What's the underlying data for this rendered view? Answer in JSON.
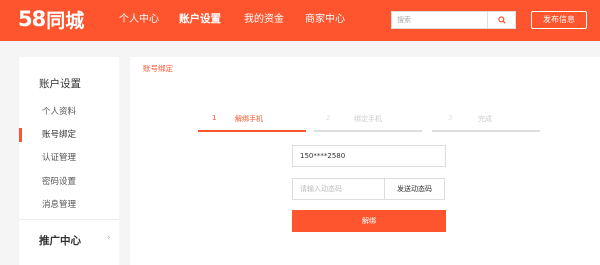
{
  "header": {
    "logo_number": "58",
    "logo_text": "同城",
    "nav": [
      "个人中心",
      "账户设置",
      "我的资金",
      "商家中心"
    ],
    "active_nav": "账户设置",
    "search_placeholder": "搜索",
    "post_button": "发布信息"
  },
  "sidebar": {
    "title": "账户设置",
    "items": [
      "个人资料",
      "账号绑定",
      "认证管理",
      "密码设置",
      "消息管理"
    ],
    "active_item": "账号绑定",
    "promo": "推广中心",
    "promo_arrow": "›"
  },
  "main": {
    "breadcrumb": "账号绑定",
    "steps": [
      {
        "num": "1",
        "label": "解绑手机"
      },
      {
        "num": "2",
        "label": "绑定手机"
      },
      {
        "num": "3",
        "label": "完成"
      }
    ],
    "active_step": 1,
    "phone_value": "150****2580",
    "code_placeholder": "请输入动态码",
    "send_code_button": "发送动态码",
    "submit_button": "解绑"
  },
  "colors": {
    "brand": "#ff552e",
    "inactive_step": "#cccccc"
  },
  "icons": [
    "search-icon",
    "chevron-right-icon"
  ]
}
